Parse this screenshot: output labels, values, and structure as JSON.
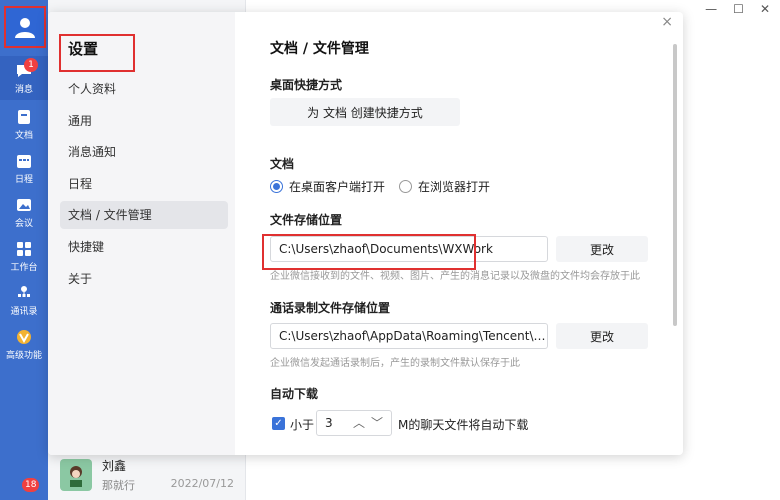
{
  "window": {
    "minimize": "—",
    "maximize": "☐",
    "close": "✕"
  },
  "rail": {
    "items": [
      {
        "label": "消息",
        "icon": "chat-bubble-icon",
        "badge": "1"
      },
      {
        "label": "文档",
        "icon": "document-icon"
      },
      {
        "label": "日程",
        "icon": "calendar-icon"
      },
      {
        "label": "会议",
        "icon": "meeting-icon"
      },
      {
        "label": "工作台",
        "icon": "workbench-icon"
      },
      {
        "label": "通讯录",
        "icon": "contacts-icon"
      },
      {
        "label": "高级功能",
        "icon": "premium-icon"
      }
    ],
    "bottom_badge": "18"
  },
  "contact": {
    "name": "刘鑫",
    "subtitle": "那就行",
    "date": "2022/07/12"
  },
  "dialog": {
    "title": "设置",
    "close": "×",
    "nav": [
      {
        "label": "个人资料"
      },
      {
        "label": "通用"
      },
      {
        "label": "消息通知"
      },
      {
        "label": "日程"
      },
      {
        "label": "文档 / 文件管理",
        "active": true
      },
      {
        "label": "快捷键"
      },
      {
        "label": "关于"
      }
    ]
  },
  "content": {
    "heading": "文档 / 文件管理",
    "shortcut": {
      "title": "桌面快捷方式",
      "button": "为 文档 创建快捷方式"
    },
    "docs": {
      "title": "文档",
      "options": [
        {
          "label": "在桌面客户端打开",
          "selected": true
        },
        {
          "label": "在浏览器打开",
          "selected": false
        }
      ]
    },
    "storage": {
      "title": "文件存储位置",
      "path": "C:\\Users\\zhaof\\Documents\\WXWork",
      "change": "更改",
      "hint": "企业微信接收到的文件、视频、图片、产生的消息记录以及微盘的文件均会存放于此"
    },
    "recording": {
      "title": "通话录制文件存储位置",
      "path": "C:\\Users\\zhaof\\AppData\\Roaming\\Tencent\\WXWork\\",
      "change": "更改",
      "hint": "企业微信发起通话录制后，产生的录制文件默认保存于此"
    },
    "autodl": {
      "title": "自动下载",
      "prefix": "小于",
      "value": "3",
      "suffix": "M的聊天文件将自动下载",
      "checked": true
    }
  },
  "colors": {
    "accent": "#3a73d9",
    "rail": "#3d6fcc",
    "highlight": "#e03030"
  }
}
